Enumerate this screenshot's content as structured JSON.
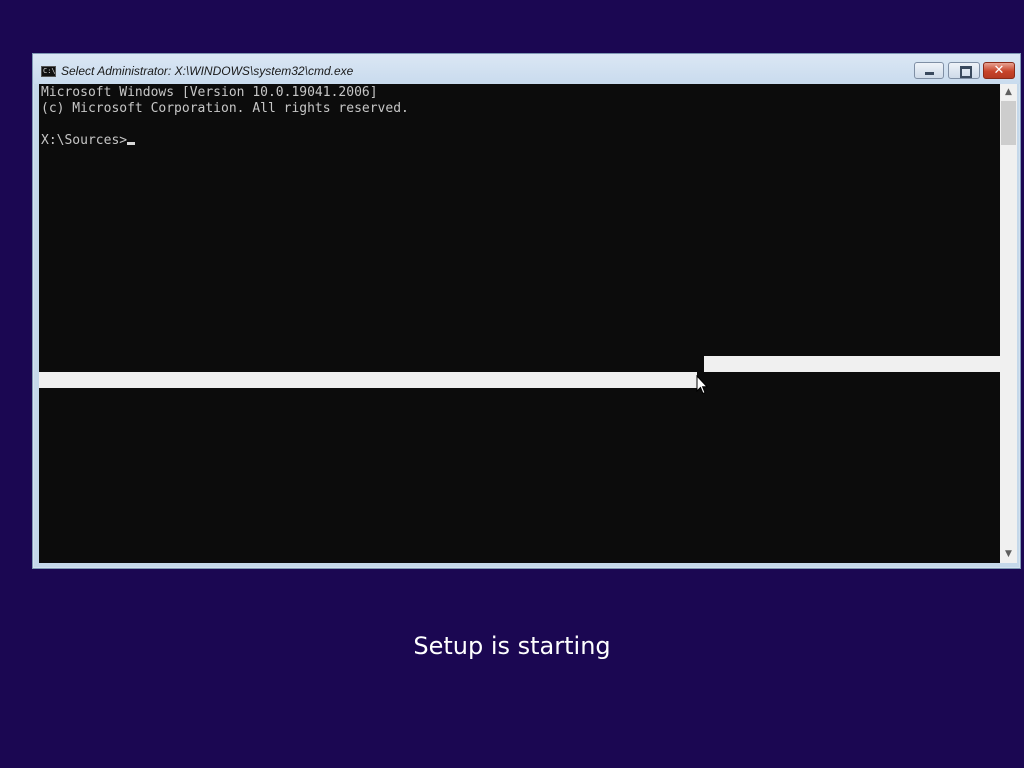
{
  "window": {
    "title": "Select Administrator: X:\\WINDOWS\\system32\\cmd.exe",
    "app_icon_text": "C:\\",
    "close_symbol": "✕",
    "scroll_up_symbol": "▲",
    "scroll_down_symbol": "▼"
  },
  "console": {
    "lines": [
      "Microsoft Windows [Version 10.0.19041.2006]",
      "(c) Microsoft Corporation. All rights reserved."
    ],
    "prompt": "X:\\Sources>",
    "background": "#0c0c0c",
    "foreground": "#c6c6c6"
  },
  "setup": {
    "status_text": "Setup is starting"
  },
  "colors": {
    "desktop_background": "#1b0752",
    "close_button": "#c8442a",
    "selection_bar": "#f0f0f0"
  },
  "icons": [
    "cmd-app-icon",
    "minimize-icon",
    "restore-icon",
    "close-icon",
    "scroll-up-arrow-icon",
    "scroll-down-arrow-icon",
    "mouse-pointer-icon"
  ]
}
